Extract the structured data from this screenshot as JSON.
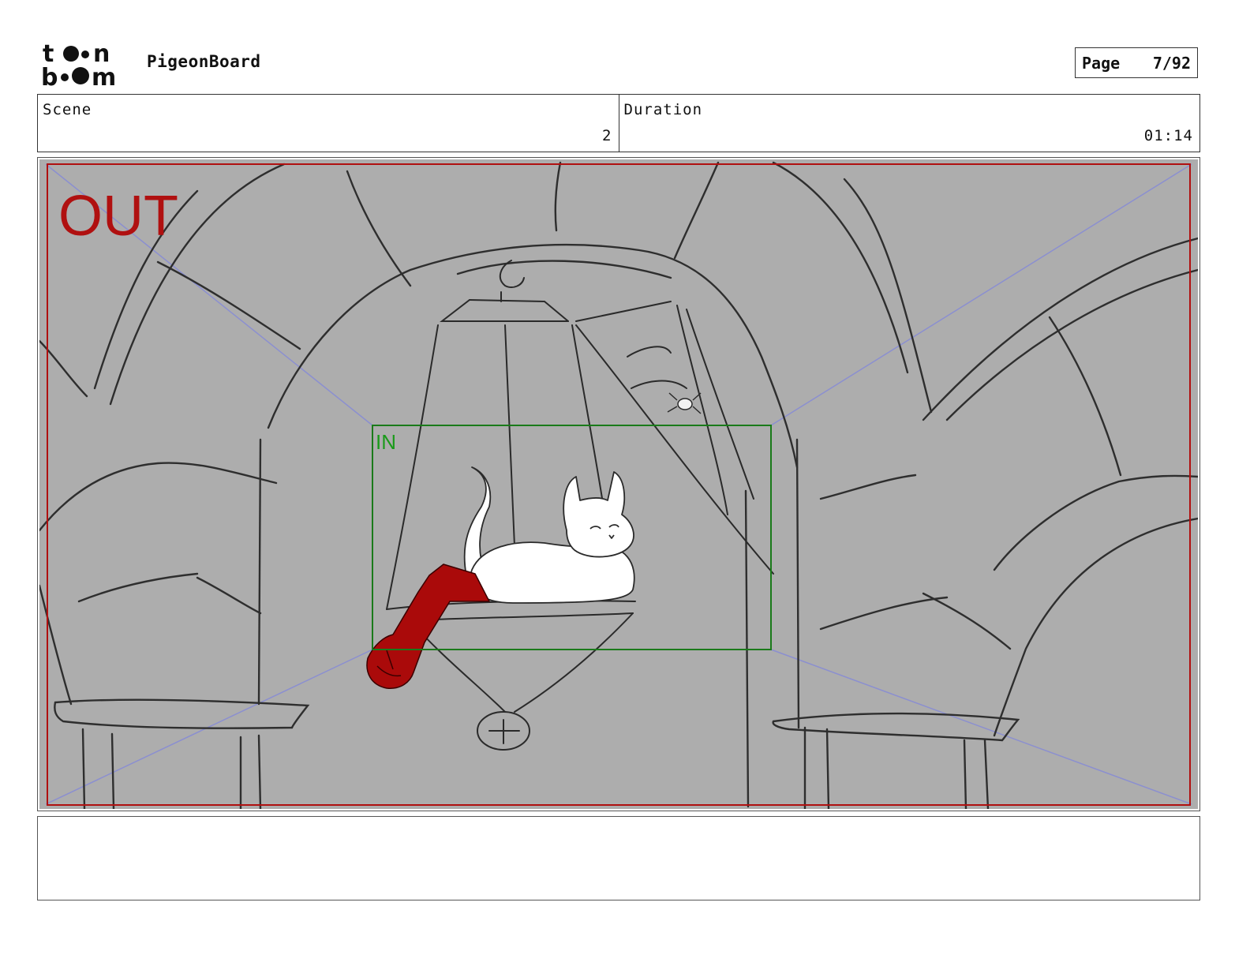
{
  "header": {
    "logo_text_top": "toon",
    "logo_text_bottom": "boom",
    "app_name": "PigeonBoard",
    "page_label": "Page",
    "page_value": "7/92"
  },
  "info": {
    "scene_label": "Scene",
    "scene_value": "2",
    "duration_label": "Duration",
    "duration_value": "01:14"
  },
  "panel": {
    "out_label": "OUT",
    "in_label": "IN",
    "colors": {
      "background": "#adadad",
      "out_frame": "#b01010",
      "in_frame": "#1a7a1a",
      "guides": "#8b8fd0",
      "sock": "#aa0a0a"
    }
  },
  "notes": {
    "text": ""
  }
}
